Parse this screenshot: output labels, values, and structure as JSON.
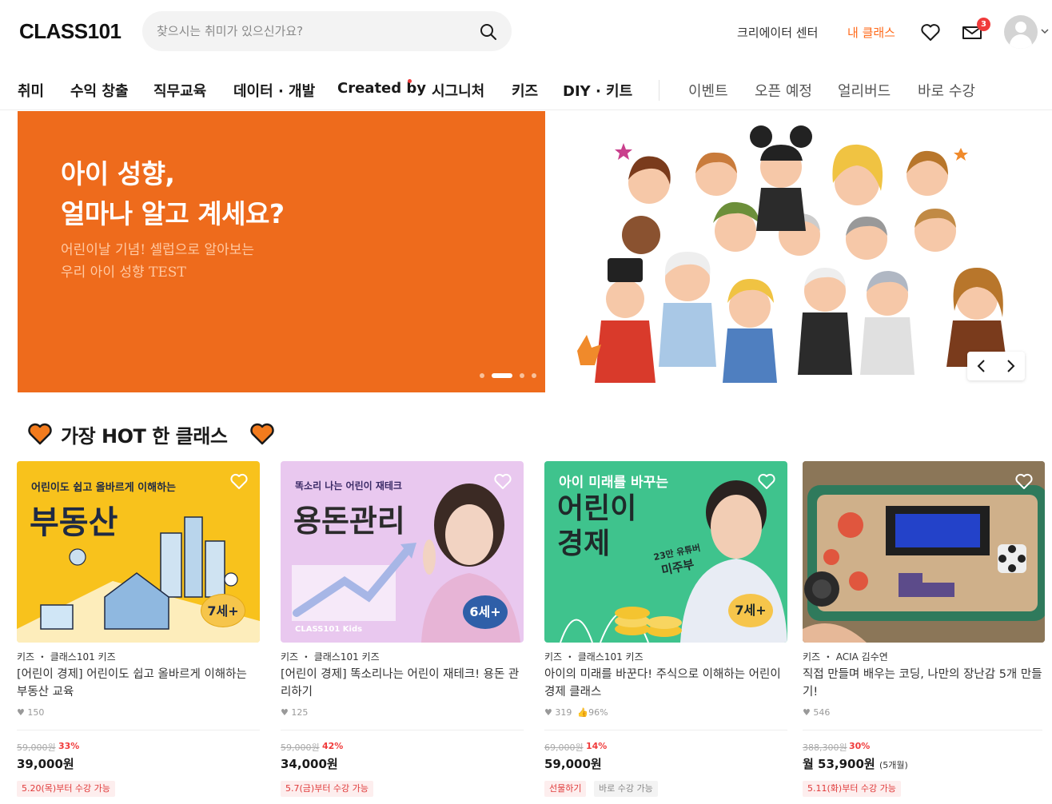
{
  "header": {
    "logo": "CLASS101",
    "search_placeholder": "찾으시는 취미가 있으신가요?",
    "creator_center": "크리에이터 센터",
    "my_class": "내 클래스",
    "cart_count": "3"
  },
  "nav": {
    "main": [
      "취미",
      "수익 창출",
      "직무교육",
      "데이터 · 개발",
      "Created by",
      "시그니처",
      "키즈",
      "DIY · 키트"
    ],
    "sub": [
      "이벤트",
      "오픈 예정",
      "얼리버드",
      "바로 수강"
    ]
  },
  "banner": {
    "title_line1": "아이 성향,",
    "title_line2": "얼마나 알고 계세요?",
    "sub_line1": "어린이날 기념! 셀럽으로 알아보는",
    "sub_line2": "우리 아이 성향 TEST",
    "bg_color": "#ee6b1c",
    "active_slide": 2,
    "slide_count": 4
  },
  "hot": {
    "title": "가장 HOT 한 클래스"
  },
  "cards": [
    {
      "thumb_top": "어린이도 쉽고 올바르게 이해하는",
      "thumb_main": "부동산",
      "age": "7세+",
      "meta": "키즈 ・ 클래스101 키즈",
      "title": "[어린이 경제] 어린이도 쉽고 올바르게 이해하는 부동산 교육",
      "likes": "150",
      "rating": "",
      "orig_price": "59,000원",
      "discount": "33%",
      "price": "39,000원",
      "price_note": "",
      "badges": [
        "5.20(목)부터 수강 가능"
      ]
    },
    {
      "thumb_top": "똑소리 나는 어린이 재테크",
      "thumb_main": "용돈관리",
      "age": "6세+",
      "brand": "CLASS101 Kids",
      "meta": "키즈 ・ 클래스101 키즈",
      "title": "[어린이 경제] 똑소리나는 어린이 재테크! 용돈 관리하기",
      "likes": "125",
      "rating": "",
      "orig_price": "59,000원",
      "discount": "42%",
      "price": "34,000원",
      "price_note": "",
      "badges": [
        "5.7(금)부터 수강 가능"
      ]
    },
    {
      "thumb_top": "아이 미래를 바꾸는",
      "thumb_main1": "어린이",
      "thumb_main2": "경제",
      "thumb_caption1": "23만 유튜버",
      "thumb_caption2": "미주부",
      "age": "7세+",
      "meta": "키즈 ・ 클래스101 키즈",
      "title": "아이의 미래를 바꾼다! 주식으로 이해하는 어린이 경제 클래스",
      "likes": "319",
      "rating": "96%",
      "orig_price": "69,000원",
      "discount": "14%",
      "price": "59,000원",
      "price_note": "",
      "badges": [
        "선물하기",
        "바로 수강 가능"
      ]
    },
    {
      "meta": "키즈 ・ ACIA 김수연",
      "title": "직접 만들며 배우는 코딩, 나만의 장난감 5개 만들기!",
      "likes": "546",
      "rating": "",
      "orig_price": "388,300원",
      "discount": "30%",
      "price": "월 53,900원",
      "price_note": "(5개월)",
      "badges": [
        "5.11(화)부터 수강 가능"
      ]
    }
  ]
}
